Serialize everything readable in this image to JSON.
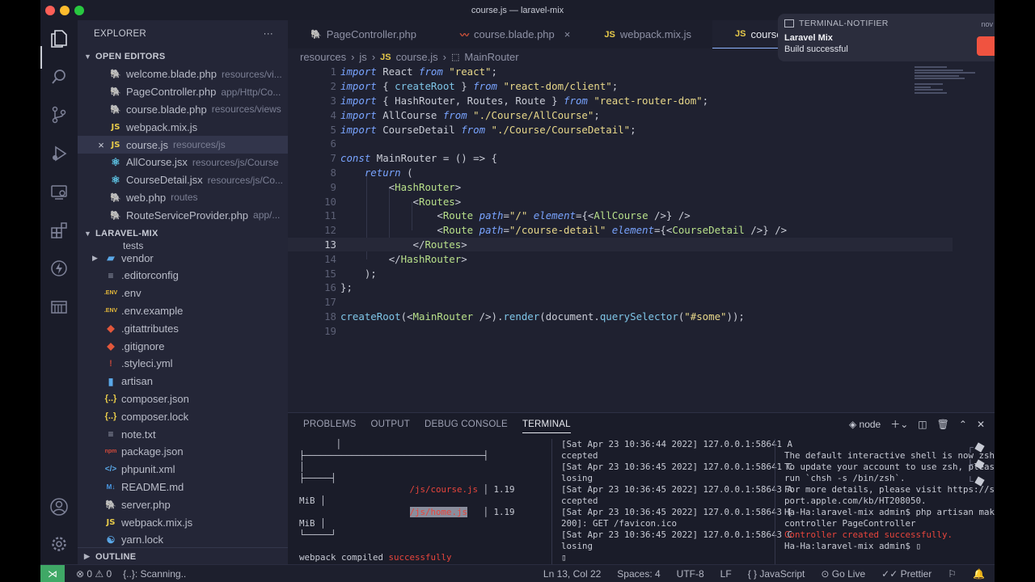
{
  "window": {
    "title": "course.js — laravel-mix"
  },
  "explorer": {
    "title": "EXPLORER",
    "more": "···",
    "open_editors_title": "OPEN EDITORS",
    "open_editors": [
      {
        "name": "welcome.blade.php",
        "path": "resources/vi...",
        "icon": "php"
      },
      {
        "name": "PageController.php",
        "path": "app/Http/Co...",
        "icon": "php"
      },
      {
        "name": "course.blade.php",
        "path": "resources/views",
        "icon": "php"
      },
      {
        "name": "webpack.mix.js",
        "path": "",
        "icon": "js"
      },
      {
        "name": "course.js",
        "path": "resources/js",
        "icon": "js"
      },
      {
        "name": "AllCourse.jsx",
        "path": "resources/js/Course",
        "icon": "react"
      },
      {
        "name": "CourseDetail.jsx",
        "path": "resources/js/Co...",
        "icon": "react"
      },
      {
        "name": "web.php",
        "path": "routes",
        "icon": "php"
      },
      {
        "name": "RouteServiceProvider.php",
        "path": "app/...",
        "icon": "php"
      }
    ],
    "project_title": "LARAVEL-MIX",
    "project_cut": "tests",
    "files": [
      {
        "name": "vendor",
        "icon": "folder",
        "glyph": "▰"
      },
      {
        "name": ".editorconfig",
        "icon": "txt",
        "glyph": "≡"
      },
      {
        "name": ".env",
        "icon": "env",
        "glyph": ".ENV"
      },
      {
        "name": ".env.example",
        "icon": "env",
        "glyph": ".ENV"
      },
      {
        "name": ".gitattributes",
        "icon": "git",
        "glyph": "◆"
      },
      {
        "name": ".gitignore",
        "icon": "git",
        "glyph": "◆"
      },
      {
        "name": ".styleci.yml",
        "icon": "yml",
        "glyph": "!"
      },
      {
        "name": "artisan",
        "icon": "file",
        "glyph": "▮"
      },
      {
        "name": "composer.json",
        "icon": "json",
        "glyph": "{..}"
      },
      {
        "name": "composer.lock",
        "icon": "json",
        "glyph": "{..}"
      },
      {
        "name": "note.txt",
        "icon": "txt",
        "glyph": "≡"
      },
      {
        "name": "package.json",
        "icon": "npm",
        "glyph": "npm"
      },
      {
        "name": "phpunit.xml",
        "icon": "xml",
        "glyph": "</>"
      },
      {
        "name": "README.md",
        "icon": "md",
        "glyph": "M↓"
      },
      {
        "name": "server.php",
        "icon": "php",
        "glyph": "🐘"
      },
      {
        "name": "webpack.mix.js",
        "icon": "js",
        "glyph": "JS"
      },
      {
        "name": "yarn.lock",
        "icon": "yarn",
        "glyph": "☯"
      }
    ],
    "outline_title": "OUTLINE"
  },
  "tabs": [
    {
      "label": "PageController.php",
      "icon": "php",
      "active": false,
      "close": ""
    },
    {
      "label": "course.blade.php",
      "icon": "blade",
      "active": false,
      "close": "×"
    },
    {
      "label": "webpack.mix.js",
      "icon": "js",
      "active": false,
      "close": ""
    },
    {
      "label": "course.js",
      "icon": "js",
      "active": true,
      "close": ""
    }
  ],
  "breadcrumb": {
    "parts": [
      "resources",
      "js",
      "course.js",
      "MainRouter"
    ],
    "sep": "›"
  },
  "editor": {
    "current_line": 13,
    "lines": [
      "import React from \"react\";",
      "import { createRoot } from \"react-dom/client\";",
      "import { HashRouter, Routes, Route } from \"react-router-dom\";",
      "import AllCourse from \"./Course/AllCourse\";",
      "import CourseDetail from \"./Course/CourseDetail\";",
      "",
      "const MainRouter = () => {",
      "    return (",
      "        <HashRouter>",
      "            <Routes>",
      "                <Route path=\"/\" element={<AllCourse />} />",
      "                <Route path=\"/course-detail\" element={<CourseDetail />} />",
      "            </Routes>",
      "        </HashRouter>",
      "    );",
      "};",
      "",
      "createRoot(<MainRouter />).render(document.querySelector(\"#some\"));",
      ""
    ]
  },
  "notification": {
    "app": "TERMINAL-NOTIFIER",
    "title": "Laravel Mix",
    "body": "Build successful",
    "time": "nov"
  },
  "panel": {
    "tabs": [
      "PROBLEMS",
      "OUTPUT",
      "DEBUG CONSOLE",
      "TERMINAL"
    ],
    "active_tab": "TERMINAL",
    "shell": "node",
    "term1": [
      "       │",
      "├──────────────────────────────────┤",
      "│",
      "├─────┤",
      "                     /js/course.js │ 1.19",
      "MiB │",
      "                     /js/home.js   │ 1.19",
      "MiB │",
      "└─────┘",
      "",
      "webpack compiled successfully",
      "▯"
    ],
    "term2": [
      "[Sat Apr 23 10:36:44 2022] 127.0.0.1:58641 A",
      "ccepted",
      "[Sat Apr 23 10:36:45 2022] 127.0.0.1:58641 C",
      "losing",
      "[Sat Apr 23 10:36:45 2022] 127.0.0.1:58643 A",
      "ccepted",
      "[Sat Apr 23 10:36:45 2022] 127.0.0.1:58643 [",
      "200]: GET /favicon.ico",
      "[Sat Apr 23 10:36:45 2022] 127.0.0.1:58643 C",
      "losing",
      "▯"
    ],
    "term3": [
      "",
      "The default interactive shell is now zsh.",
      "To update your account to use zsh, please",
      "run `chsh -s /bin/zsh`.",
      "For more details, please visit https://sup",
      "port.apple.com/kb/HT208050.",
      "Ha-Ha:laravel-mix admin$ php artisan make:",
      "controller PageController",
      "Controller created successfully.",
      "Ha-Ha:laravel-mix admin$ ▯"
    ]
  },
  "status": {
    "problems": "⊗ 0  ⚠ 0",
    "scanning": "{..}: Scanning..",
    "position": "Ln 13, Col 22",
    "spaces": "Spaces: 4",
    "encoding": "UTF-8",
    "eol": "LF",
    "language": "{ } JavaScript",
    "golive": "⊙ Go Live",
    "prettier": "✓✓ Prettier"
  },
  "colors": {
    "accent": "#3fa866",
    "notif_logo": "#f05340"
  }
}
